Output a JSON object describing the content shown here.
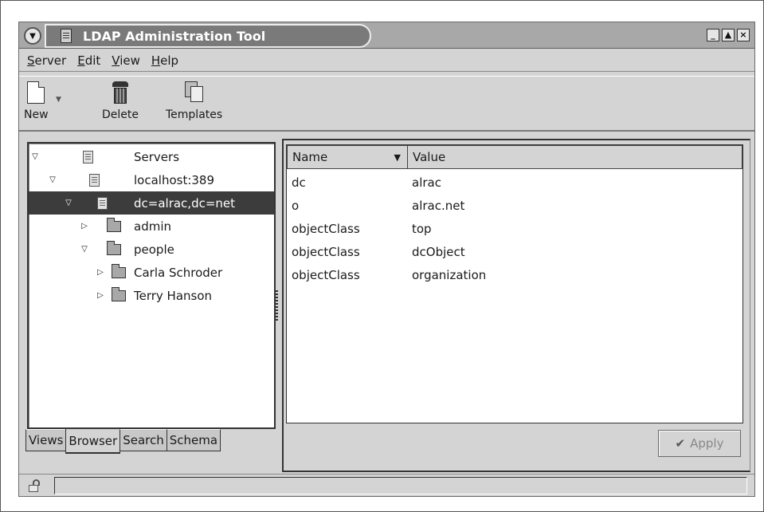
{
  "window": {
    "title": "LDAP Administration Tool",
    "controls": [
      "minimize",
      "maximize",
      "close"
    ]
  },
  "menubar": {
    "items": [
      {
        "first": "S",
        "rest": "erver"
      },
      {
        "first": "E",
        "rest": "dit"
      },
      {
        "first": "V",
        "rest": "iew"
      },
      {
        "first": "H",
        "rest": "elp"
      }
    ]
  },
  "toolbar": {
    "new_label": "New",
    "delete_label": "Delete",
    "templates_label": "Templates"
  },
  "tree": {
    "nodes": [
      {
        "label": "Servers",
        "expander": "▽",
        "icon": "server-icon"
      },
      {
        "label": "localhost:389",
        "expander": "▽",
        "icon": "server-icon"
      },
      {
        "label": "dc=alrac,dc=net",
        "expander": "▽",
        "icon": "server-icon",
        "selected": true
      },
      {
        "label": "admin",
        "expander": "▷",
        "icon": "folder-icon"
      },
      {
        "label": "people",
        "expander": "▽",
        "icon": "folder-icon"
      },
      {
        "label": "Carla Schroder",
        "expander": "▷",
        "icon": "folder-icon"
      },
      {
        "label": "Terry Hanson",
        "expander": "▷",
        "icon": "folder-icon"
      }
    ]
  },
  "tabs": [
    {
      "label": "Views"
    },
    {
      "label": "Browser",
      "active": true
    },
    {
      "label": "Search"
    },
    {
      "label": "Schema"
    }
  ],
  "attributes": {
    "columns": {
      "name": "Name",
      "value": "Value"
    },
    "rows": [
      {
        "name": "dc",
        "value": "alrac"
      },
      {
        "name": "o",
        "value": "alrac.net"
      },
      {
        "name": "objectClass",
        "value": "top"
      },
      {
        "name": "objectClass",
        "value": "dcObject"
      },
      {
        "name": "objectClass",
        "value": "organization"
      }
    ]
  },
  "apply_button": {
    "label": "Apply",
    "enabled": false
  },
  "statusbar": {
    "text": ""
  }
}
